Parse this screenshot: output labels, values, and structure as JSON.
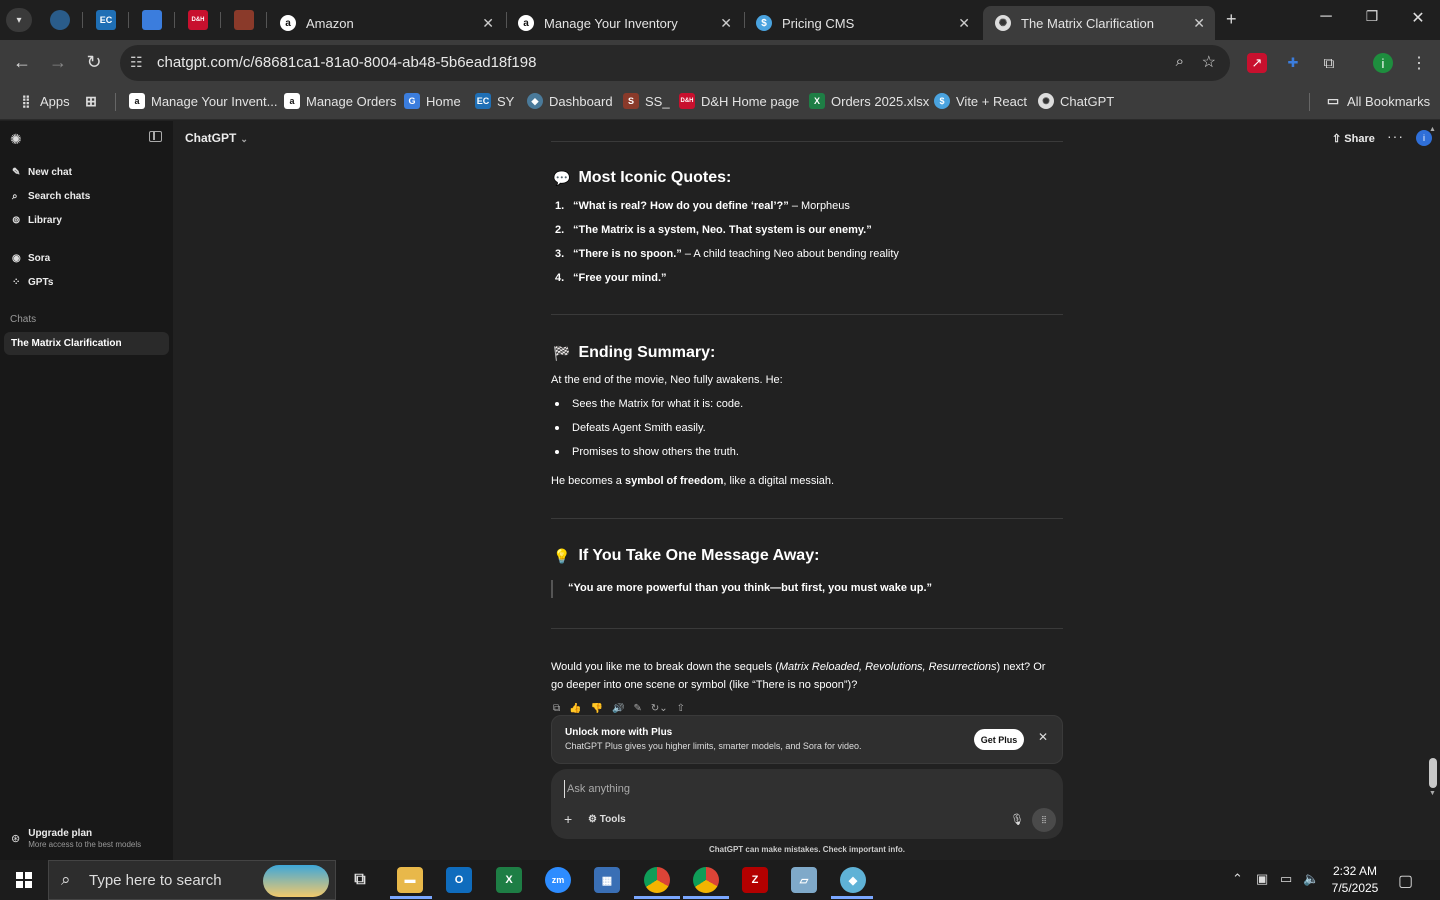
{
  "browser": {
    "tabs": [
      {
        "title": "Amazon",
        "active": false
      },
      {
        "title": "Manage Your Inventory",
        "active": false
      },
      {
        "title": "Pricing CMS",
        "active": false
      },
      {
        "title": "The Matrix Clarification",
        "active": true
      }
    ],
    "pinned_tabs": [
      "pin-1",
      "EC",
      "pin-3",
      "D&H",
      "pin-5"
    ],
    "url": "chatgpt.com/c/68681ca1-81a0-8004-ab48-5b6ead18f198",
    "bookmarks": [
      {
        "label": "Apps",
        "icon": "apps-grid-icon"
      },
      {
        "label": "Manage Your Invent...",
        "icon": "amazon-icon"
      },
      {
        "label": "Manage Orders",
        "icon": "amazon-icon"
      },
      {
        "label": "Home",
        "icon": "home-site-icon"
      },
      {
        "label": "SY",
        "icon": "ec-icon"
      },
      {
        "label": "Dashboard",
        "icon": "dashboard-icon"
      },
      {
        "label": "SS_",
        "icon": "ss-icon"
      },
      {
        "label": "D&H Home page",
        "icon": "dh-icon"
      },
      {
        "label": "Orders 2025.xlsx",
        "icon": "excel-icon"
      },
      {
        "label": "Vite + React",
        "icon": "vite-icon"
      },
      {
        "label": "ChatGPT",
        "icon": "chatgpt-icon"
      }
    ],
    "all_bookmarks": "All Bookmarks",
    "profile_initial": "i"
  },
  "sidebar": {
    "items": [
      {
        "label": "New chat",
        "icon": "edit-icon"
      },
      {
        "label": "Search chats",
        "icon": "search-icon"
      },
      {
        "label": "Library",
        "icon": "library-icon"
      },
      {
        "label": "Sora",
        "icon": "sora-icon"
      },
      {
        "label": "GPTs",
        "icon": "gpts-icon"
      }
    ],
    "section": "Chats",
    "chats": [
      "The Matrix Clarification"
    ],
    "upgrade_title": "Upgrade plan",
    "upgrade_subtitle": "More access to the best models"
  },
  "header": {
    "model": "ChatGPT",
    "share": "Share",
    "avatar": "i"
  },
  "content": {
    "quotes_heading": "Most Iconic Quotes:",
    "quotes": [
      {
        "n": "1.",
        "quote": "“What is real? How do you define ‘real’?”",
        "rest": " – Morpheus"
      },
      {
        "n": "2.",
        "quote": "“The Matrix is a system, Neo. That system is our enemy.”",
        "rest": ""
      },
      {
        "n": "3.",
        "quote": "“There is no spoon.”",
        "rest": " – A child teaching Neo about bending reality"
      },
      {
        "n": "4.",
        "quote": "“Free your mind.”",
        "rest": ""
      }
    ],
    "summary_heading": "Ending Summary:",
    "summary_intro": "At the end of the movie, Neo fully awakens. He:",
    "summary_bullets": [
      "Sees the Matrix for what it is: code.",
      "Defeats Agent Smith easily.",
      "Promises to show others the truth."
    ],
    "summary_close_pre": "He becomes a ",
    "summary_close_bold": "symbol of freedom",
    "summary_close_post": ", like a digital messiah.",
    "message_heading": "If You Take One Message Away:",
    "message_quote": "“You are more powerful than you think—but first, you must wake up.”",
    "followup_pre": "Would you like me to break down the sequels (",
    "followup_italic": "Matrix Reloaded, Revolutions, Resurrections",
    "followup_post": ") next? Or go deeper into one scene or symbol (like “There is no spoon”)?"
  },
  "banner": {
    "title": "Unlock more with Plus",
    "subtitle": "ChatGPT Plus gives you higher limits, smarter models, and Sora for video.",
    "button": "Get Plus"
  },
  "composer": {
    "placeholder": "Ask anything",
    "tools": "Tools"
  },
  "disclaimer": "ChatGPT can make mistakes. Check important info.",
  "taskbar": {
    "search_placeholder": "Type here to search",
    "time": "2:32 AM",
    "date": "7/5/2025"
  }
}
